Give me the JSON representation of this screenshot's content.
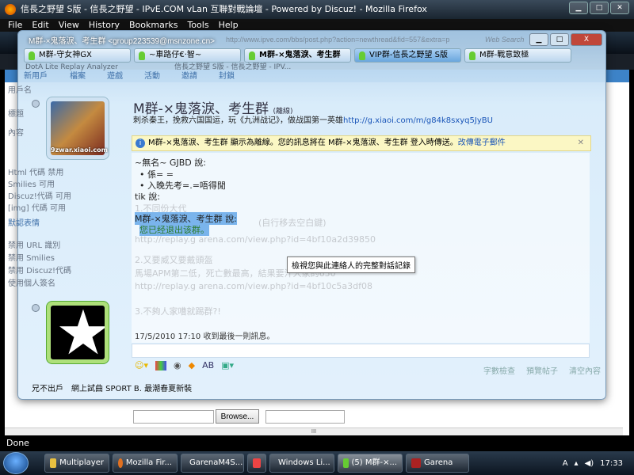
{
  "firefox": {
    "title": "信長之野望 S版 - 信長之野望 - IPvE.COM vLan 互聯對戰論壇 - Powered by Discuz! - Mozilla Firefox",
    "menu": [
      "File",
      "Edit",
      "View",
      "History",
      "Bookmarks",
      "Tools",
      "Help"
    ],
    "url": "http://www.ipve.com/bbs/post.php?action=newthread&fid=557&extra=p",
    "search_placeholder": "Web Search",
    "tabs": [
      "DotA Lite Replay Analyzer",
      "信長之野望 S版 - 信長之野望 - IPV..."
    ],
    "status": "Done"
  },
  "forum": {
    "nav": [
      "新用戶",
      "檔案",
      "遊戲",
      "活動",
      "邀請",
      "封鎖"
    ],
    "left": [
      "用戶名",
      "標題",
      "內容",
      "Html 代碼 禁用",
      "Smilies 可用",
      "Discuz!代碼 可用",
      "[img] 代碼 可用",
      "默認表情",
      "禁用 URL 識別",
      "禁用 Smilies",
      "禁用 Discuz!代碼",
      "使用個人簽名"
    ],
    "upload_browse": "Browse...",
    "hscroll": "III"
  },
  "msn": {
    "title": "M群-×鬼落淚、考生群 <group223539@msnzone.cn>",
    "tabs": [
      {
        "label": "M群-守女神GX"
      },
      {
        "label": "~車路仔€‧智~"
      },
      {
        "label": "M群-×鬼落淚、考生群"
      },
      {
        "label": "VIP群-信長之野望 S版"
      },
      {
        "label": "M群-戰意致極"
      }
    ],
    "contact_name": "M群-×鬼落淚、考生群",
    "contact_status": "(離線)",
    "psm_text": "刺杀秦王，挽救六国国运，玩《九洲战记》，做战国第一英雄",
    "psm_link": "http://g.xiaoi.com/m/g84k8sxyq5JyBU",
    "avatar_caption": "9zwar.xiaoi.com",
    "info_text": "M群-×鬼落淚、考生群 顯示為離線。您的訊息將在 M群-×鬼落淚、考生群 登入時傳送。",
    "info_link": "改傳電子郵件",
    "messages": {
      "s1": "~無名~ GJBD 說:",
      "m1": "• 係= =",
      "m2": "• 入晚先考=.=唔得閒",
      "s2": "tik 說:",
      "f1": "1.不同份大代",
      "s3": "M群-×鬼落淚、考生群 說:",
      "m3": "您已经退出该群。",
      "f2": "(自行移去空白鍵)",
      "f3": "http://replay.g arena.com/view.php?id=4bf10a2d39850",
      "f4": "2.又要威又要戴頭盔",
      "f5": "馬場APM第二低，死亡數最高，結果要汁人家的650",
      "f6": "http://replay.g arena.com/view.php?id=4bf10c5a3df08",
      "f7": "3.不夠人家嘈就踢群?!"
    },
    "tooltip": "檢視您與此連絡人的完整對話記錄",
    "last_message": "17/5/2010 17:10 收到最後一則訊息。",
    "right_links": [
      "字數檢查",
      "預覽帖子",
      "清空內容"
    ],
    "ticker": "兄不出戶　網上試曲 SPORT B. 最潮春夏新裝"
  },
  "taskbar": {
    "items": [
      "Multiplayer",
      "Mozilla Fir...",
      "GarenaM4S...",
      "",
      "Windows Li...",
      "(5) M群-×...",
      "Garena"
    ],
    "clock": "17:33"
  }
}
